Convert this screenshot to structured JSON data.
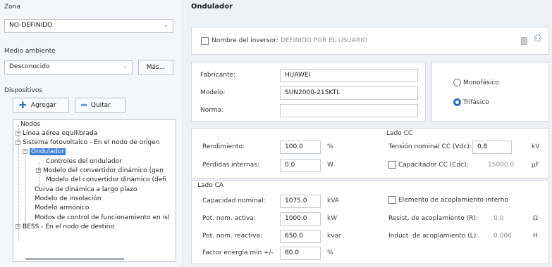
{
  "left": {
    "zona_label": "Zona",
    "zona_value": "NO-DEFINIDO",
    "medio_label": "Medio ambiente",
    "medio_value": "Desconocido",
    "mas_label": "Más...",
    "dispositivos_label": "Dispositivos",
    "agregar_label": "Agregar",
    "quitar_label": "Quitar",
    "tree": [
      "Nodos",
      "Línea aérea equilibrada",
      "Sistema fotovoltaico - En el nodo de origen",
      "Ondulador",
      "Controles del ondulador",
      "Modelo del convertidor dinámico (gen",
      "Modelo del convertidor dinámico (defi",
      "Curva de dinámica a largo plazo",
      "Modelo de insolación",
      "Modelo armónico",
      "Modos de control de funcionamiento en isl",
      "BESS - En el nodo de destino"
    ]
  },
  "right": {
    "title": "Ondulador",
    "nombre_label": "Nombre del inversor:",
    "nombre_value": "DEFINIDO POR EL USUARIO",
    "fabricante_label": "Fabricante:",
    "fabricante_value": "HUAWEI",
    "modelo_label": "Modelo:",
    "modelo_value": "SUN2000-215KTL",
    "norma_label": "Norma:",
    "norma_value": "",
    "monofasico_label": "Monofásico",
    "trifasico_label": "Trifásico",
    "phase_selected": "Trifásico",
    "rendimiento_label": "Rendimiento:",
    "rendimiento_value": "100.0",
    "rendimiento_unit": "%",
    "perdidas_label": "Pérdidas internas:",
    "perdidas_value": "0.0",
    "perdidas_unit": "W",
    "lado_cc_label": "Lado CC",
    "tension_label": "Tensión nominal CC (Vdc):",
    "tension_value": "0.8",
    "tension_unit": "kV",
    "capacitador_label": "Capacitador CC (Cdc):",
    "capacitador_value": "15000.0",
    "capacitador_unit": "µF",
    "lado_ca_label": "Lado CA",
    "capacidad_label": "Capacidad nominal:",
    "capacidad_value": "1075.0",
    "capacidad_unit": "kVA",
    "pot_activa_label": "Pot. nom. activa:",
    "pot_activa_value": "1000.0",
    "pot_activa_unit": "kW",
    "pot_reactiva_label": "Pot. nom. reactiva:",
    "pot_reactiva_value": "650.0",
    "pot_reactiva_unit": "kvar",
    "factor_label": "Factor energía mín",
    "factor_pm": "+/-",
    "factor_value": "80.0",
    "factor_unit": "%",
    "elemento_label": "Elemento de acoplamiento interno",
    "resist_label": "Resist. de acoplamiento (R):",
    "resist_value": "0.0",
    "resist_unit": "Ω",
    "induct_label": "Induct. de acoplamiento (L):",
    "induct_value": "0.006",
    "induct_unit": "H"
  }
}
